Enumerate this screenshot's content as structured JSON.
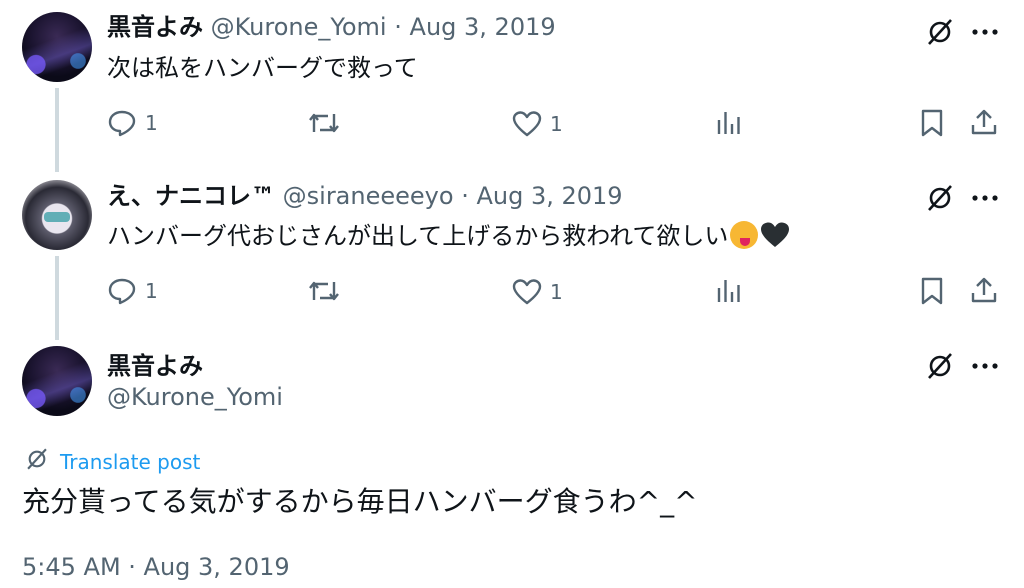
{
  "tweets": [
    {
      "name": "黒音よみ",
      "handle": "@Kurone_Yomi",
      "sep": "·",
      "date": "Aug 3, 2019",
      "text": "次は私をハンバーグで救って",
      "replies": "1",
      "likes": "1"
    },
    {
      "name": "え、ナニコレ™",
      "handle": "@siraneeeeyo",
      "sep": "·",
      "date": "Aug 3, 2019",
      "text": "ハンバーグ代おじさんが出して上げるから救われて欲しい",
      "replies": "1",
      "likes": "1"
    }
  ],
  "main": {
    "name": "黒音よみ",
    "handle": "@Kurone_Yomi",
    "translate_label": "Translate post",
    "text": "充分貰ってる気がするから毎日ハンバーグ食うわ^_^",
    "timestamp": "5:45 AM · Aug 3, 2019"
  },
  "icons": {
    "reply": "reply-bubble-icon",
    "retweet": "retweet-icon",
    "like": "heart-icon",
    "views": "analytics-bars-icon",
    "bookmark": "bookmark-icon",
    "share": "share-upload-icon",
    "grok": "grok-slash-icon",
    "more": "more-dots-icon"
  },
  "colors": {
    "text": "#0f1419",
    "secondary": "#536471",
    "link": "#1d9bf0",
    "thread_line": "#cfd9de"
  }
}
